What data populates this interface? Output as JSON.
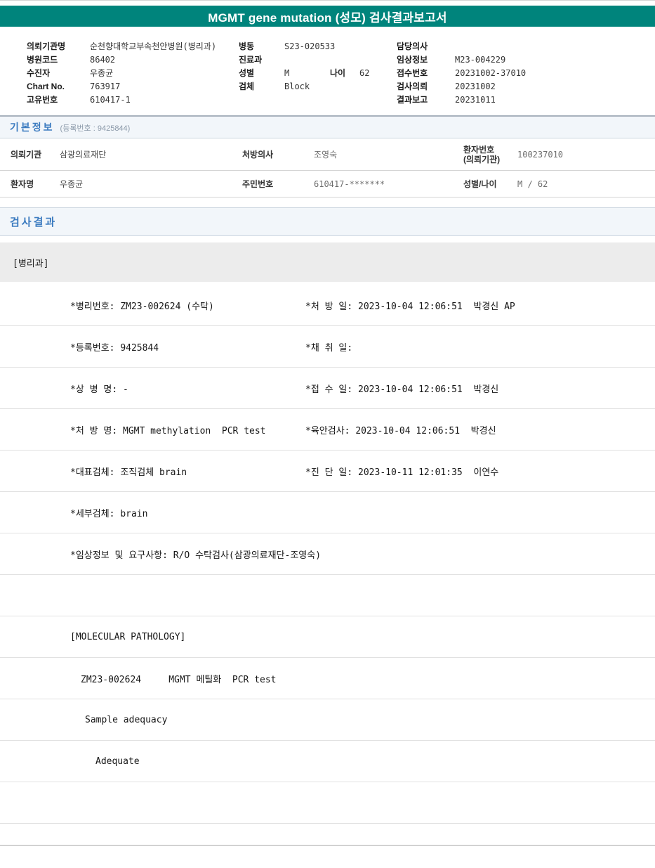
{
  "page": {
    "title": "MGMT gene mutation (성모) 검사결과보고서"
  },
  "header": {
    "left": [
      {
        "label": "의뢰기관명",
        "value": "순천향대학교부속천안병원(병리과)"
      },
      {
        "label": "병원코드",
        "value": "86402"
      },
      {
        "label": "수진자",
        "value": "우종균"
      },
      {
        "label": "Chart No.",
        "value": "763917"
      },
      {
        "label": "고유번호",
        "value": "610417-1"
      }
    ],
    "middle": [
      {
        "label": "병동",
        "value": "S23-020533"
      },
      {
        "label": "진료과",
        "value": ""
      },
      {
        "label": "성별",
        "value": "M"
      },
      {
        "label": "검체",
        "value": "Block"
      }
    ],
    "age_label": "나이",
    "age_value": "62",
    "right": [
      {
        "label": "담당의사",
        "value": ""
      },
      {
        "label": "임상정보",
        "value": "M23-004229"
      },
      {
        "label": "접수번호",
        "value": "20231002-37010"
      },
      {
        "label": "검사의뢰",
        "value": "20231002"
      },
      {
        "label": "결과보고",
        "value": "20231011"
      }
    ]
  },
  "basic_info": {
    "title": "기본정보",
    "subtitle": "(등록번호 : 9425844)",
    "row1": {
      "l1": "의뢰기관",
      "v1": "삼광의료재단",
      "l2": "처방의사",
      "v2": "조영숙",
      "l3a": "환자번호",
      "l3b": "(의뢰기관)",
      "v3": "100237010"
    },
    "row2": {
      "l1": "환자명",
      "v1": "우종균",
      "l2": "주민번호",
      "v2": "610417-*******",
      "l3": "성별/나이",
      "v3": "M / 62"
    }
  },
  "results": {
    "title": "검사결과",
    "department": "[병리과]",
    "rows": [
      {
        "left": "*병리번호: ZM23-002624 (수탁)",
        "right": "*처 방 일: 2023-10-04 12:06:51  박경신 AP"
      },
      {
        "left": "*등록번호: 9425844",
        "right": "*채 취 일:"
      },
      {
        "left": "*상 병 명: -",
        "right": "*접 수 일: 2023-10-04 12:06:51  박경신"
      },
      {
        "left": "*처 방 명: MGMT methylation  PCR test",
        "right": "*육안검사: 2023-10-04 12:06:51  박경신"
      },
      {
        "left": "*대표검체: 조직검체 brain",
        "right": "*진 단 일: 2023-10-11 12:01:35  이연수"
      },
      {
        "left": "*세부검체: brain",
        "right": ""
      },
      {
        "left": "*임상정보 및 요구사항: R/O 수탁검사(삼광의료재단-조영숙)",
        "right": ""
      },
      {
        "left": "",
        "right": ""
      },
      {
        "left": "[MOLECULAR PATHOLOGY]",
        "right": ""
      },
      {
        "left": "ZM23-002624     MGMT 메틸화  PCR test",
        "right": ""
      },
      {
        "left": "Sample adequacy",
        "right": ""
      },
      {
        "left": "Adequate",
        "right": ""
      },
      {
        "left": "",
        "right": ""
      }
    ]
  }
}
